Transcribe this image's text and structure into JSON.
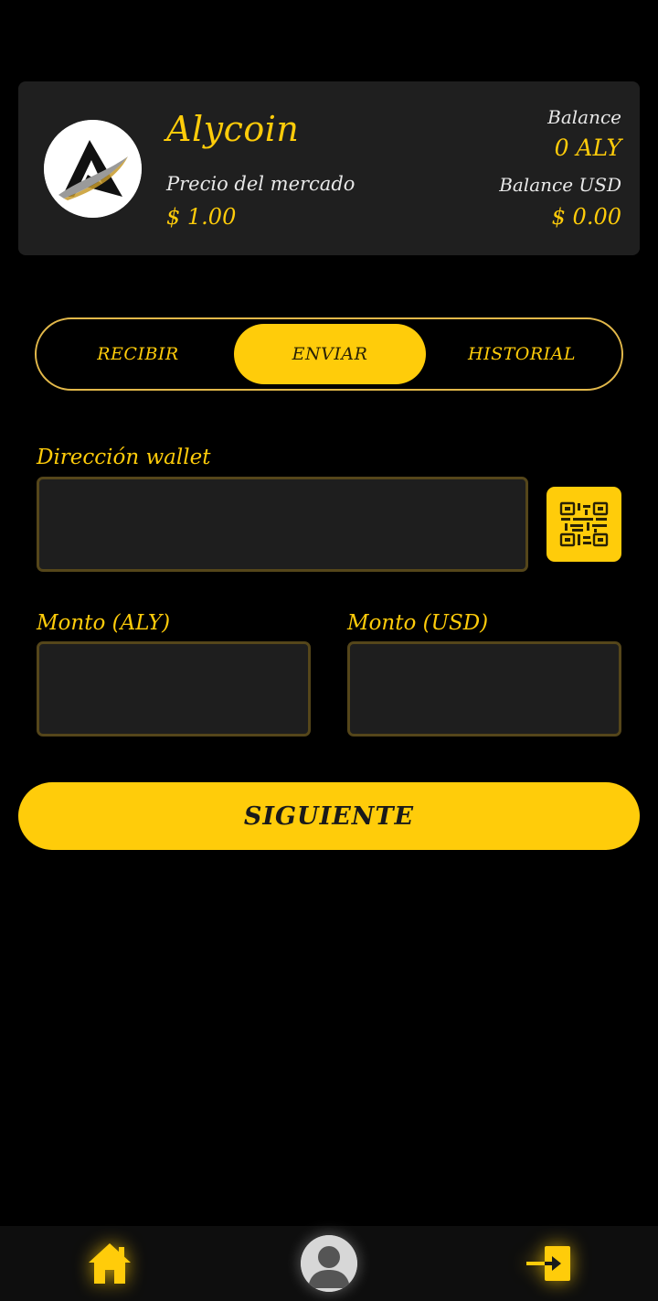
{
  "coin": {
    "name": "Alycoin",
    "logo_icon": "alycoin-logo",
    "market_label": "Precio del mercado",
    "market_value": "$ 1.00",
    "balance_label": "Balance",
    "balance_value": "0 ALY",
    "balance_usd_label": "Balance USD",
    "balance_usd_value": "$ 0.00"
  },
  "tabs": [
    {
      "label": "RECIBIR",
      "active": false
    },
    {
      "label": "ENVIAR",
      "active": true
    },
    {
      "label": "HISTORIAL",
      "active": false
    }
  ],
  "form": {
    "wallet_label": "Dirección wallet",
    "wallet_value": "",
    "qr_icon": "qr-code-icon",
    "amount_aly_label": "Monto (ALY)",
    "amount_aly_value": "",
    "amount_usd_label": "Monto (USD)",
    "amount_usd_value": "",
    "next_label": "SIGUIENTE"
  },
  "bottom_nav": {
    "home_icon": "home-icon",
    "profile_icon": "avatar-icon",
    "logout_icon": "logout-icon"
  },
  "colors": {
    "accent": "#ffcc0a",
    "background": "#000000",
    "card": "#1f1f1f",
    "field": "#1e1e1e",
    "field_border": "#55461a"
  }
}
